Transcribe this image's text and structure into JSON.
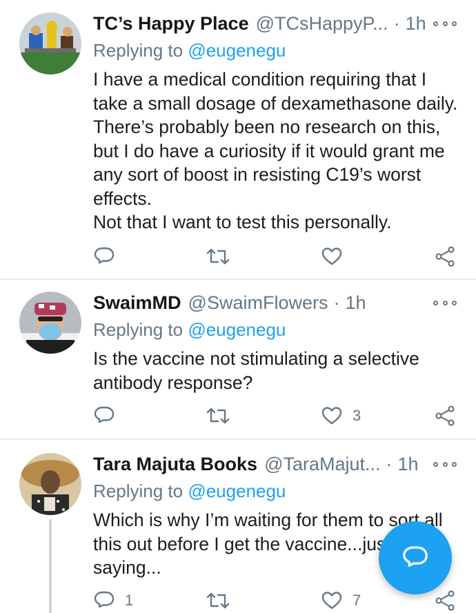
{
  "tweets": [
    {
      "name": "TC’s Happy Place",
      "handle": "@TCsHappyP...",
      "dot": "·",
      "time": "1h",
      "replying_prefix": "Replying to",
      "replying_to": "@eugenegu",
      "text": "I have a medical condition requiring that I take a small dosage of dexamethasone daily. There’s probably been no research on this, but I do have a curiosity if it would grant me any sort of boost in resisting C19’s worst effects.",
      "text2": "Not that I want to test this personally.",
      "reply_count": "",
      "retweet_count": "",
      "like_count": ""
    },
    {
      "name": "SwaimMD",
      "handle": "@SwaimFlowers",
      "dot": "·",
      "time": "1h",
      "replying_prefix": "Replying to",
      "replying_to": "@eugenegu",
      "text": "Is the vaccine not stimulating a selective antibody response?",
      "reply_count": "",
      "retweet_count": "",
      "like_count": "3"
    },
    {
      "name": "Tara Majuta Books",
      "handle": "@TaraMajut...",
      "dot": "·",
      "time": "1h",
      "replying_prefix": "Replying to",
      "replying_to": "@eugenegu",
      "text": "Which is why I’m waiting for them to sort all this out before I get the vaccine...just saying...",
      "reply_count": "1",
      "retweet_count": "",
      "like_count": "7"
    }
  ],
  "icons": {
    "reply": "reply-icon",
    "retweet": "retweet-icon",
    "like": "heart-icon",
    "share": "share-icon",
    "more": "more-options-icon",
    "compose": "compose-reply-icon"
  },
  "colors": {
    "accent": "#1da1f2",
    "secondary_text": "#657786",
    "divider": "#e6ecf0"
  }
}
